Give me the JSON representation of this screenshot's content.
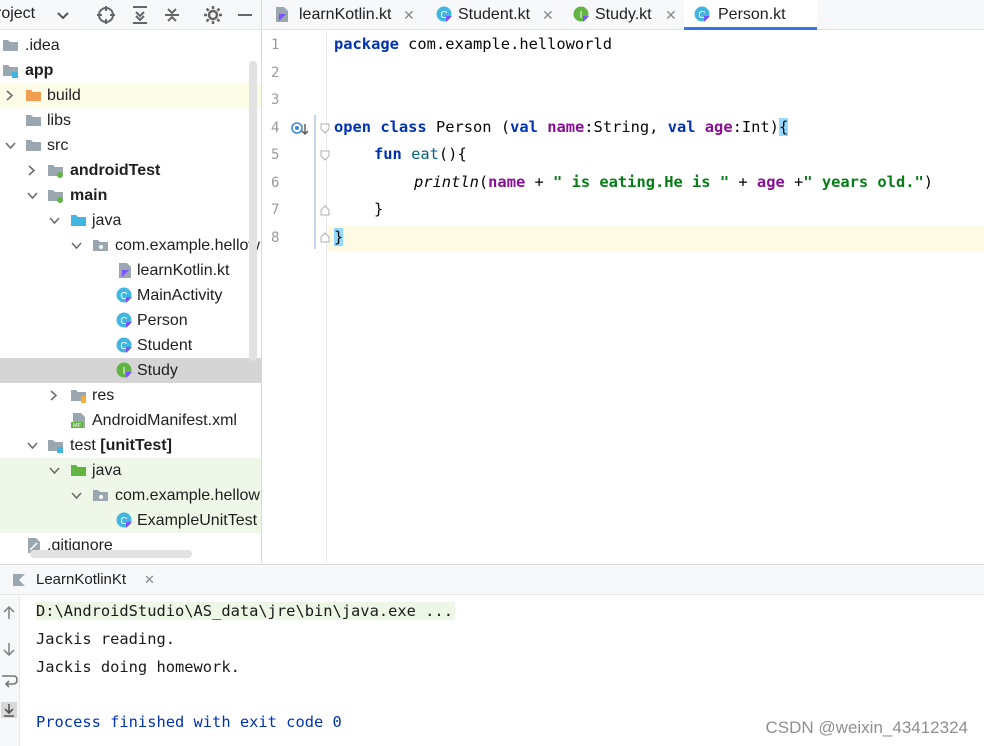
{
  "project_panel": {
    "title": "roject",
    "tree": [
      {
        "label": ".idea",
        "icon": "folder-icon"
      },
      {
        "label": "app",
        "icon": "module-folder-icon"
      },
      {
        "label": "build",
        "icon": "excluded-folder-icon"
      },
      {
        "label": "libs",
        "icon": "folder-icon"
      },
      {
        "label": "src",
        "icon": "folder-icon"
      },
      {
        "label": "androidTest",
        "icon": "test-folder-icon"
      },
      {
        "label": "main",
        "icon": "source-folder-icon"
      },
      {
        "label": "java",
        "icon": "source-root-icon"
      },
      {
        "label": "com.example.hellow",
        "icon": "package-icon"
      },
      {
        "label": "learnKotlin.kt",
        "icon": "kotlin-file-icon"
      },
      {
        "label": "MainActivity",
        "icon": "kotlin-class-icon"
      },
      {
        "label": "Person",
        "icon": "kotlin-class-icon"
      },
      {
        "label": "Student",
        "icon": "kotlin-class-icon"
      },
      {
        "label": "Study",
        "icon": "kotlin-interface-icon"
      },
      {
        "label": "res",
        "icon": "resources-folder-icon"
      },
      {
        "label": "AndroidManifest.xml",
        "icon": "manifest-icon"
      },
      {
        "label": "test",
        "label_suffix": "[unitTest]",
        "icon": "module-folder-icon"
      },
      {
        "label": "java",
        "icon": "test-root-icon"
      },
      {
        "label": "com.example.hellow",
        "icon": "package-icon"
      },
      {
        "label": "ExampleUnitTest",
        "icon": "kotlin-class-icon"
      },
      {
        "label": ".gitignore",
        "icon": "ignore-file-icon"
      }
    ]
  },
  "tabs": [
    {
      "label": "learnKotlin.kt",
      "icon": "kotlin-file-icon",
      "active": false
    },
    {
      "label": "Student.kt",
      "icon": "kotlin-class-icon",
      "active": false
    },
    {
      "label": "Study.kt",
      "icon": "kotlin-interface-icon",
      "active": false
    },
    {
      "label": "Person.kt",
      "icon": "kotlin-class-icon",
      "active": true
    }
  ],
  "editor": {
    "line_numbers": [
      "1",
      "2",
      "3",
      "4",
      "5",
      "6",
      "7",
      "8"
    ],
    "code": {
      "l1_kw": "package",
      "l1_rest": " com.example.helloworld",
      "l4_kw_open": "open",
      "l4_kw_class": "class",
      "l4_name": " Person (",
      "l4_val1": "val",
      "l4_prop1": "name",
      "l4_type1": ":String, ",
      "l4_val2": "val",
      "l4_prop2": "age",
      "l4_type2": ":Int)",
      "l4_brace": "{",
      "l5_kw": "fun",
      "l5_fn": "eat",
      "l5_rest": "(){",
      "l6_fn": "println",
      "l6_p1": "(",
      "l6_prop1": "name",
      "l6_p2": " + ",
      "l6_str1": "\" is eating.He is \"",
      "l6_p3": " + ",
      "l6_prop2": "age",
      "l6_p4": " +",
      "l6_str2": "\" years old.\"",
      "l6_p5": ")",
      "l7": "}",
      "l8": "}"
    }
  },
  "run_panel": {
    "tab_label": "LearnKotlinKt",
    "lines": [
      "D:\\AndroidStudio\\AS_data\\jre\\bin\\java.exe ...",
      "Jackis reading.",
      "Jackis doing homework.",
      "",
      "Process finished with exit code 0"
    ]
  },
  "watermark": "CSDN @weixin_43412324",
  "colors": {
    "keyword": "#0033b3",
    "property": "#871094",
    "string": "#067d17",
    "function": "#00627a",
    "active_tab": "#3574f0"
  }
}
